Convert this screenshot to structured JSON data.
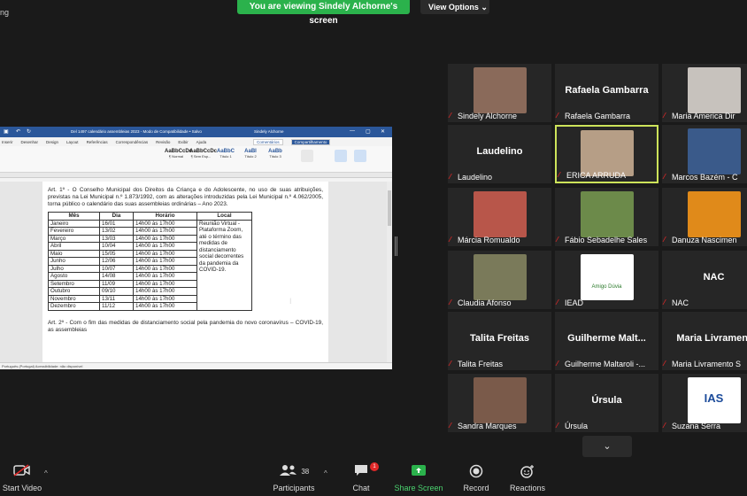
{
  "banner": {
    "text": "You are viewing Sindely Alchorne's screen",
    "view_options": "View Options"
  },
  "top_left_text": "ng",
  "word": {
    "title": "Del 1497 calendário assembleias 2023 - Modo de Compatibilidade • Salvo",
    "user": "Sindely Alchorne",
    "menu": [
      "Inserir",
      "Desenhar",
      "Design",
      "Layout",
      "Referências",
      "Correspondências",
      "Revisão",
      "Exibir",
      "Ajuda"
    ],
    "comments_label": "Comentários",
    "share_label": "Compartilhamento",
    "styles": [
      {
        "sample": "AaBbCcDc",
        "label": "¶ Normal"
      },
      {
        "sample": "AaBbCcDc",
        "label": "¶ Sem Esp..."
      },
      {
        "sample": "AaBbC",
        "label": "Título 1"
      },
      {
        "sample": "AaBI",
        "label": "Título 2"
      },
      {
        "sample": "AaBb",
        "label": "Título 3"
      }
    ],
    "paragraph1": "Art. 1º - O Conselho Municipal dos Direitos da Criança e do Adolescente, no uso de suas atribuições, previstas na Lei Municipal n.º 1.873/1992, com as alterações introduzidas pela Lei Municipal n.º 4.062/2005, torna público o calendário das suas assembleias ordinárias – Ano 2023.",
    "table": {
      "headers": [
        "Mês",
        "Dia",
        "Horário",
        "Local"
      ],
      "rows": [
        [
          "Janeiro",
          "16/01",
          "14h00 às 17h00"
        ],
        [
          "Fevereiro",
          "13/02",
          "14h00 às 17h00"
        ],
        [
          "Março",
          "13/03",
          "14h00 às 17h00"
        ],
        [
          "Abril",
          "10/04",
          "14h00 às 17h00"
        ],
        [
          "Maio",
          "15/05",
          "14h00 às 17h00"
        ],
        [
          "Junho",
          "12/06",
          "14h00 às 17h00"
        ],
        [
          "Julho",
          "10/07",
          "14h00 às 17h00"
        ],
        [
          "Agosto",
          "14/08",
          "14h00 às 17h00"
        ],
        [
          "Setembro",
          "11/09",
          "14h00 às 17h00"
        ],
        [
          "Outubro",
          "09/10",
          "14h00 às 17h00"
        ],
        [
          "Novembro",
          "13/11",
          "14h00 às 17h00"
        ],
        [
          "Dezembro",
          "11/12",
          "14h00 às 17h00"
        ]
      ],
      "location": "Reunião Virtual - Plataforma Zoom, até o término das medidas de distanciamento social decorrentes da pandemia da COVID-19."
    },
    "paragraph2": "Art. 2º - Com o fim das medidas de distanciamento social pela pandemia do novo coronavírus – COVID-19, as assembleias",
    "status": "Português (Portugal)   Acessibilidade: não disponível"
  },
  "participants": [
    {
      "name": "Sindely Alchorne",
      "big": "",
      "photo": "#8a6a5a"
    },
    {
      "name": "Rafaela Gambarra",
      "big": "Rafaela Gambarra",
      "photo": ""
    },
    {
      "name": "Maria America Dir",
      "big": "",
      "photo": "#c7c2bd"
    },
    {
      "name": "Laudelino",
      "big": "Laudelino",
      "photo": ""
    },
    {
      "name": "ERICA ARRUDA",
      "big": "",
      "photo": "#b69e86"
    },
    {
      "name": "Marcos Bazém - C",
      "big": "",
      "photo": "#3a5a8a"
    },
    {
      "name": "Márcia Romualdo",
      "big": "",
      "photo": "#b8564a"
    },
    {
      "name": "Fábio Sebadelhe Sales",
      "big": "",
      "photo": "#6c8a4a"
    },
    {
      "name": "Danuza Nascimen",
      "big": "",
      "photo": "#e08a1a"
    },
    {
      "name": "Claudia Afonso",
      "big": "",
      "photo": "#7a7a5a"
    },
    {
      "name": "IEAD",
      "big": "",
      "photo": "#ffffff"
    },
    {
      "name": "NAC",
      "big": "NAC",
      "photo": ""
    },
    {
      "name": "Talita Freitas",
      "big": "Talita Freitas",
      "photo": ""
    },
    {
      "name": "Guilherme Maltaroli -...",
      "big": "Guilherme Malt...",
      "photo": ""
    },
    {
      "name": "Maria Livramento S",
      "big": "Maria Livrament",
      "photo": ""
    },
    {
      "name": "Sandra Marques",
      "big": "",
      "photo": "#7a5a4a"
    },
    {
      "name": "Úrsula",
      "big": "Úrsula",
      "photo": ""
    },
    {
      "name": "Suzana Serra",
      "big": "",
      "photo": "#ffffff"
    }
  ],
  "iead_logo_text": "Amigo Dúvia",
  "ias_logo_text": "IAS",
  "toolbar": {
    "start_video": "Start Video",
    "participants": "Participants",
    "participants_count": "38",
    "chat": "Chat",
    "chat_badge": "1",
    "share_screen": "Share Screen",
    "record": "Record",
    "reactions": "Reactions"
  },
  "colors": {
    "banner": "#2bb24c",
    "active_speaker": "#cde35a",
    "muted": "#e02828",
    "word_blue": "#2b579a"
  }
}
